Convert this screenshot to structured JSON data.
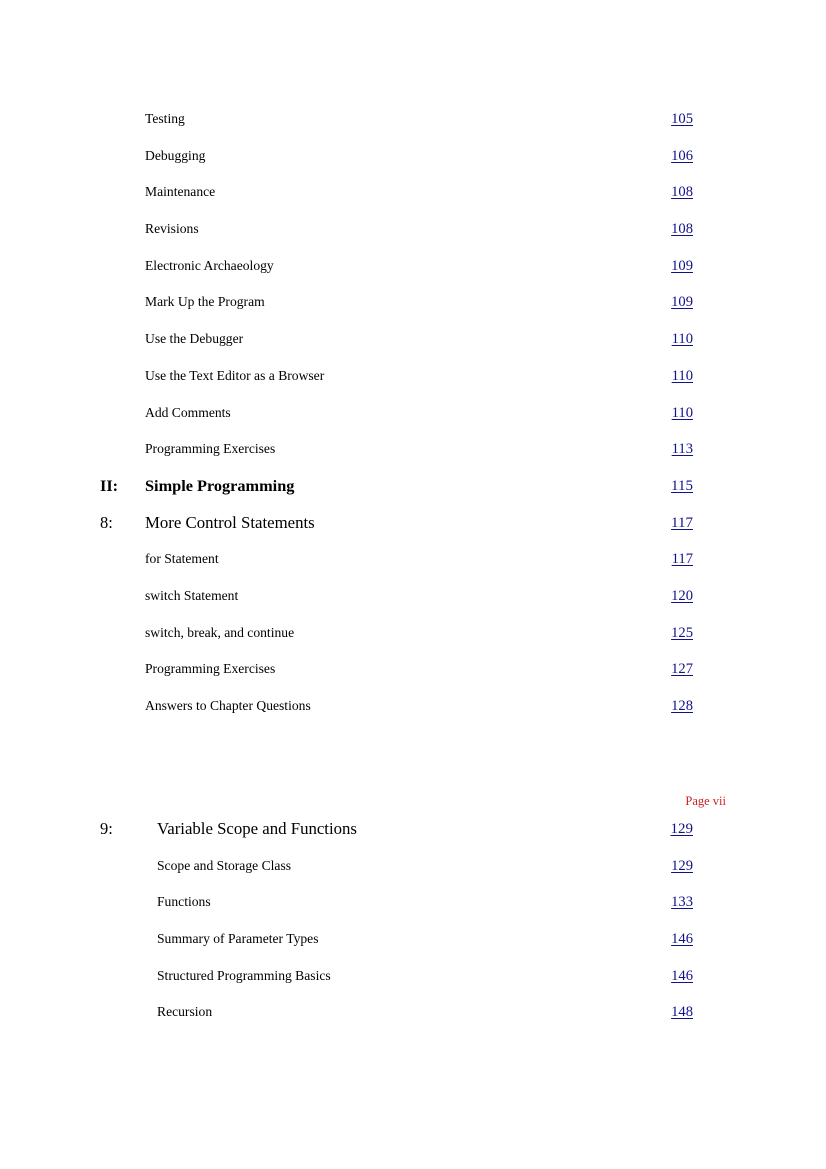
{
  "document": {
    "type": "table-of-contents",
    "page_marker": "Page vii",
    "page_marker_color": "#cc2222",
    "link_color": "#111188",
    "background_color": "#ffffff"
  },
  "upper_block": {
    "rows": [
      {
        "kind": "sub",
        "number": "",
        "label": "Testing",
        "page": "105"
      },
      {
        "kind": "sub",
        "number": "",
        "label": "Debugging",
        "page": "106"
      },
      {
        "kind": "sub",
        "number": "",
        "label": "Maintenance",
        "page": "108"
      },
      {
        "kind": "sub",
        "number": "",
        "label": "Revisions",
        "page": "108"
      },
      {
        "kind": "sub",
        "number": "",
        "label": "Electronic Archaeology",
        "page": "109"
      },
      {
        "kind": "sub",
        "number": "",
        "label": "Mark Up the Program",
        "page": "109"
      },
      {
        "kind": "sub",
        "number": "",
        "label": "Use the Debugger",
        "page": "110"
      },
      {
        "kind": "sub",
        "number": "",
        "label": "Use the Text Editor as a Browser",
        "page": "110"
      },
      {
        "kind": "sub",
        "number": "",
        "label": "Add Comments",
        "page": "110"
      },
      {
        "kind": "sub",
        "number": "",
        "label": "Programming Exercises",
        "page": "113"
      },
      {
        "kind": "part",
        "number": "II:",
        "label": "Simple Programming",
        "page": "115"
      },
      {
        "kind": "chapter",
        "number": "8:",
        "label": "More Control Statements",
        "page": "117"
      },
      {
        "kind": "sub",
        "number": "",
        "label": "for Statement",
        "page": "117"
      },
      {
        "kind": "sub",
        "number": "",
        "label": "switch Statement",
        "page": "120"
      },
      {
        "kind": "sub",
        "number": "",
        "label": "switch, break, and continue",
        "page": "125"
      },
      {
        "kind": "sub",
        "number": "",
        "label": "Programming Exercises",
        "page": "127"
      },
      {
        "kind": "sub",
        "number": "",
        "label": "Answers to Chapter Questions",
        "page": "128"
      }
    ]
  },
  "lower_block": {
    "rows": [
      {
        "kind": "chapter",
        "number": "9:",
        "label": "Variable Scope and Functions",
        "page": "129"
      },
      {
        "kind": "sub",
        "number": "",
        "label": "Scope and Storage Class",
        "page": "129"
      },
      {
        "kind": "sub",
        "number": "",
        "label": "Functions",
        "page": "133"
      },
      {
        "kind": "sub",
        "number": "",
        "label": "Summary of Parameter Types",
        "page": "146"
      },
      {
        "kind": "sub",
        "number": "",
        "label": "Structured Programming Basics",
        "page": "146"
      },
      {
        "kind": "sub",
        "number": "",
        "label": "Recursion",
        "page": "148"
      }
    ]
  }
}
